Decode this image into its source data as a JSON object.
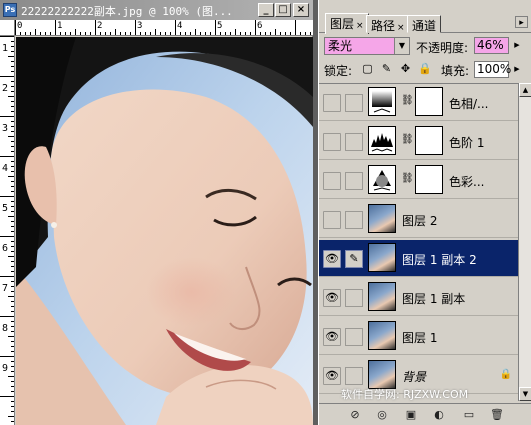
{
  "document": {
    "title": "22222222222副本.jpg @ 100% (图...",
    "app_icon_label": "Ps",
    "window_buttons": {
      "minimize": "_",
      "maximize": "□",
      "close": "×"
    },
    "ruler_top": [
      "0",
      "1",
      "2",
      "3",
      "4",
      "5",
      "6"
    ],
    "ruler_left": [
      "1",
      "2",
      "3",
      "4",
      "5",
      "6",
      "7",
      "8",
      "9"
    ]
  },
  "panel": {
    "tabs": [
      {
        "label": "图层",
        "close": "×"
      },
      {
        "label": "路径",
        "close": "×"
      },
      {
        "label": "通道",
        "close": ""
      }
    ],
    "menu_glyph": "▸",
    "blend_mode": "柔光",
    "opacity_label": "不透明度:",
    "opacity_value": "46%",
    "lock_label": "锁定:",
    "fill_label": "填充:",
    "fill_value": "100%",
    "lock_icons": [
      "▢",
      "✎",
      "✥",
      "🔒"
    ],
    "layers": [
      {
        "name": "色相/...",
        "kind": "hue-saturation",
        "visible": false,
        "selected": false,
        "mask": true
      },
      {
        "name": "色阶 1",
        "kind": "levels",
        "visible": false,
        "selected": false,
        "mask": true
      },
      {
        "name": "色彩...",
        "kind": "color-balance",
        "visible": false,
        "selected": false,
        "mask": true
      },
      {
        "name": "图层 2",
        "kind": "photo",
        "visible": false,
        "selected": false
      },
      {
        "name": "图层 1 副本 2",
        "kind": "photo",
        "visible": true,
        "selected": true
      },
      {
        "name": "图层 1 副本",
        "kind": "photo",
        "visible": true,
        "selected": false
      },
      {
        "name": "图层 1",
        "kind": "photo",
        "visible": true,
        "selected": false
      },
      {
        "name": "背景",
        "kind": "photo",
        "visible": true,
        "selected": false,
        "locked": true
      }
    ],
    "watermark": "软件自学网: RJZXW.COM",
    "bottom_buttons": [
      "⊘",
      "◎",
      "▣",
      "◐",
      "▭",
      "🗑"
    ]
  },
  "colors": {
    "selection": "#0a246a",
    "blend_field": "#f5a6e8",
    "opacity_field": "#f5a6e8"
  }
}
